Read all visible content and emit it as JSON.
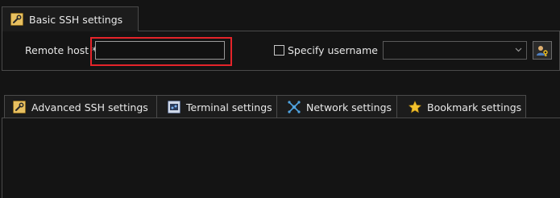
{
  "basic_tab": {
    "label": "Basic SSH settings",
    "icon": "wrench-icon"
  },
  "basic_settings": {
    "remote_host_label": "Remote host *",
    "remote_host_value": "",
    "specify_username_label": "Specify username",
    "specify_username_checked": false,
    "username_value": "",
    "user_button_icon": "user-key-icon"
  },
  "lower_tabs": [
    {
      "label": "Advanced SSH settings",
      "icon": "wrench-icon"
    },
    {
      "label": "Terminal settings",
      "icon": "terminal-icon"
    },
    {
      "label": "Network settings",
      "icon": "network-icon"
    },
    {
      "label": "Bookmark settings",
      "icon": "star-icon"
    }
  ],
  "colors": {
    "background": "#141414",
    "border": "#4a4a4a",
    "highlight": "#e5242a",
    "star": "#f2c12e",
    "network": "#4fa3e0"
  }
}
